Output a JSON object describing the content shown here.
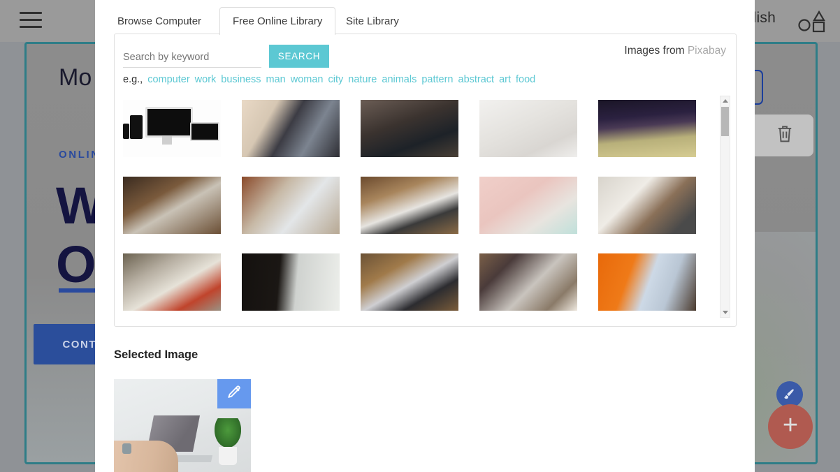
{
  "background_editor": {
    "menu_icon": "hamburger-menu-icon",
    "publish_label": "Publish",
    "shapes_icon": "shapes-icon",
    "section_heading": "Mo",
    "eyebrow": "ONLINE SO",
    "big_title_line1": "We",
    "big_title_line2": "Op",
    "cta_label": "CONTAC",
    "toolbar": {
      "settings_icon": "gear-icon",
      "delete_icon": "trash-icon"
    },
    "fab_brush_icon": "paintbrush-icon",
    "fab_add_label": "+",
    "accent_teal": "#2f7d87",
    "accent_blue": "#2b4e9b",
    "accent_red": "#b05a50"
  },
  "modal": {
    "tabs": [
      {
        "label": "Browse Computer",
        "active": false
      },
      {
        "label": "Free Online Library",
        "active": true
      },
      {
        "label": "Site Library",
        "active": false
      }
    ],
    "search": {
      "value": "",
      "placeholder": "Search by keyword",
      "button_label": "SEARCH",
      "button_color": "#5cc8d3"
    },
    "attribution": {
      "prefix": "Images from ",
      "source": "Pixabay"
    },
    "keywords": {
      "prefix": "e.g.,",
      "items": [
        "computer",
        "work",
        "business",
        "man",
        "woman",
        "city",
        "nature",
        "animals",
        "pattern",
        "abstract",
        "art",
        "food"
      ],
      "link_color": "#5cc8d3"
    },
    "grid": {
      "columns": 5,
      "rows": 3,
      "images": [
        {
          "alt": "black desktop monitor tablet and phones on white",
          "style": "t-devices"
        },
        {
          "alt": "person browsing on laptop at table",
          "style": "t-laptopuser"
        },
        {
          "alt": "hands holding smartphone over laptop",
          "style": "t-handphone"
        },
        {
          "alt": "silver laptop on white bed with coffee and donut",
          "style": "t-bedlaptop"
        },
        {
          "alt": "laptop and mouse on desk in dark office",
          "style": "t-darkoffice"
        },
        {
          "alt": "open laptop on wooden desk with coffee cup",
          "style": "t-wooddesk"
        },
        {
          "alt": "woman typing on laptop with notebook and coffee",
          "style": "t-womantype"
        },
        {
          "alt": "laptop notebook and phone flat lay on wood",
          "style": "t-laptopover"
        },
        {
          "alt": "mint headphones keyboard and mouse on pink background",
          "style": "t-pinkflat"
        },
        {
          "alt": "laptop with smartphone on open notebook",
          "style": "t-phonebook"
        },
        {
          "alt": "open notebook pen and red coffee cup near laptop",
          "style": "t-notebook"
        },
        {
          "alt": "silhouette of woman working on laptop by window",
          "style": "t-silhouette"
        },
        {
          "alt": "person typing on laptop at wooden table",
          "style": "t-deskwork"
        },
        {
          "alt": "woman in floral top using laptop with cappuccino",
          "style": "t-cappuccino"
        },
        {
          "alt": "man writing in notebook against orange wall",
          "style": "t-orangewall"
        }
      ]
    },
    "scrollbar": {
      "up_icon": "scroll-up-arrow-icon",
      "down_icon": "scroll-down-arrow-icon",
      "position": "top"
    },
    "selected": {
      "title": "Selected Image",
      "edit_icon": "pencil-edit-icon",
      "edit_button_color": "#6699ee",
      "alt": "hands typing on laptop next to small potted plant"
    }
  }
}
